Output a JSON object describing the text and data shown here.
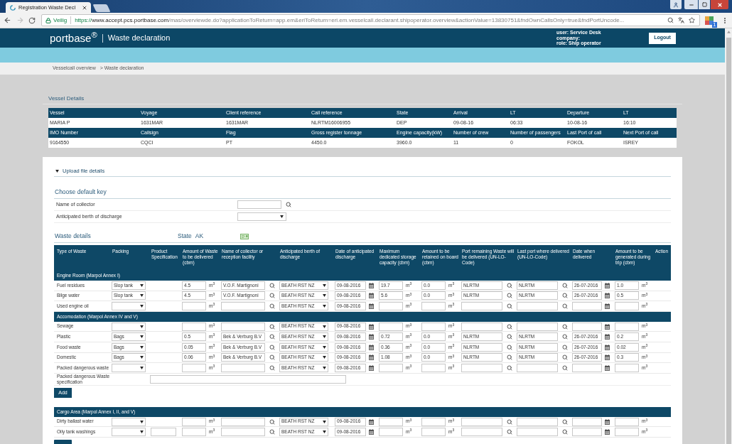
{
  "browser": {
    "tab_title": "Registration Waste Decl",
    "security_label": "Veilig",
    "url": {
      "scheme": "https://",
      "host": "www.accept.pcs.portbase.com",
      "path": "/mas/overviewde.do?applicationToReturn=app.em&eriToReturn=eri.em.vesselcall.declarant.shipoperator.overview&actionValue=13830751&fndOwnCallsOnly=true&fndPortUncode..."
    },
    "extension_badge": "1"
  },
  "header": {
    "logo": "portbase$^{®}$",
    "title": "Waste declaration",
    "user_lines": [
      "user: Service Desk",
      "company:",
      "role: Ship operator"
    ],
    "logout": "Logout"
  },
  "breadcrumb": [
    "Vesselcall overview",
    "> Waste declaration"
  ],
  "vessel_details": {
    "title": "Vessel Details",
    "groups": [
      {
        "columns": [
          "Vessel",
          "Voyage",
          "Client reference",
          "Call reference",
          "State",
          "Arrival",
          "LT",
          "Departure",
          "LT"
        ],
        "values": [
          "MARIA P",
          "1631MAR",
          "1631MAR",
          "NLRTM16006955",
          "DEP",
          "09-08-16",
          "06:33",
          "10-08-16",
          "16:10"
        ]
      },
      {
        "columns": [
          "IMO Number",
          "Callsign",
          "Flag",
          "Gross register tonnage",
          "Engine capacity(kW)",
          "Number of crew",
          "Number of passengers",
          "Last Port of call",
          "Next Port of call"
        ],
        "values": [
          "9164550",
          "CQCI",
          "PT",
          "4450.0",
          "3960.0",
          "11",
          "0",
          "FOKOL",
          "ISREY"
        ]
      }
    ]
  },
  "upload": {
    "label": "Upload file details"
  },
  "default_key": {
    "title": "Choose default key",
    "fields": [
      {
        "label": "Name of collector",
        "kind": "search"
      },
      {
        "label": "Anticipated berth of discharge",
        "kind": "select"
      }
    ]
  },
  "waste_details": {
    "title": "Waste details",
    "state_label": "State",
    "state_value": "AK"
  },
  "waste_table": {
    "columns": [
      "Type of Waste",
      "Packing",
      "Product Specification",
      "Amount of Waste to be delivered (cbm)",
      "Name of collector or reception facility",
      "Anticipated berth of discharge",
      "Date of anticipated discharge",
      "Maximum dedicated storage capacity (cbm)",
      "Amount to be retained on board (cbm)",
      "Port remaining Waste will be delivered (UN-LO-Code)",
      "Last port where delivered (UN-LO-Code)",
      "Date when delivered",
      "Amount to be generated during trip (cbm)",
      "Action"
    ],
    "sections": [
      {
        "title": "Engine Room (Marpol Annex I)",
        "rows": [
          {
            "type": "Fuel residues",
            "cells": [
              {
                "kind": "select",
                "value": "Slop tank"
              },
              {
                "kind": "blank"
              },
              {
                "kind": "input",
                "value": "4.5",
                "unit": "m$^{3}$"
              },
              {
                "kind": "search",
                "value": "V.O.F. Martignoni"
              },
              {
                "kind": "select",
                "value": "BEATH RST NZ"
              },
              {
                "kind": "date",
                "value": "09-08-2016"
              },
              {
                "kind": "input",
                "value": "19.7",
                "unit": "m$^{3}$"
              },
              {
                "kind": "input",
                "value": "0.0",
                "unit": "m$^{3}$"
              },
              {
                "kind": "search",
                "value": "NLRTM"
              },
              {
                "kind": "search",
                "value": "NLRTM"
              },
              {
                "kind": "date",
                "value": "26-07-2016"
              },
              {
                "kind": "input",
                "value": "1.0",
                "unit": "m$^{3}$"
              }
            ]
          },
          {
            "type": "Bilge water",
            "cells": [
              {
                "kind": "select",
                "value": "Slop tank"
              },
              {
                "kind": "blank"
              },
              {
                "kind": "input",
                "value": "4.5",
                "unit": "m$^{3}$"
              },
              {
                "kind": "search",
                "value": "V.O.F. Martignoni"
              },
              {
                "kind": "select",
                "value": "BEATH RST NZ"
              },
              {
                "kind": "date",
                "value": "09-08-2016"
              },
              {
                "kind": "input",
                "value": "5.6",
                "unit": "m$^{3}$"
              },
              {
                "kind": "input",
                "value": "0.0",
                "unit": "m$^{3}$"
              },
              {
                "kind": "search",
                "value": "NLRTM"
              },
              {
                "kind": "search",
                "value": "NLRTM"
              },
              {
                "kind": "date",
                "value": "26-07-2016"
              },
              {
                "kind": "input",
                "value": "0.5",
                "unit": "m$^{3}$"
              }
            ]
          },
          {
            "type": "Used engine oil",
            "cells": [
              {
                "kind": "select"
              },
              {
                "kind": "blank"
              },
              {
                "kind": "input",
                "unit": "m$^{3}$"
              },
              {
                "kind": "search"
              },
              {
                "kind": "select",
                "value": "BEATH RST NZ"
              },
              {
                "kind": "date",
                "value": "09-08-2016"
              },
              {
                "kind": "input",
                "unit": "m$^{3}$"
              },
              {
                "kind": "input",
                "unit": "m$^{3}$"
              },
              {
                "kind": "search"
              },
              {
                "kind": "search"
              },
              {
                "kind": "date"
              },
              {
                "kind": "input",
                "unit": "m$^{3}$"
              }
            ]
          }
        ]
      },
      {
        "title": "Accomodation (Marpol Annex IV and V)",
        "rows": [
          {
            "type": "Sewage",
            "cells": [
              {
                "kind": "select"
              },
              {
                "kind": "blank"
              },
              {
                "kind": "input",
                "unit": "m$^{3}$"
              },
              {
                "kind": "search"
              },
              {
                "kind": "select",
                "value": "BEATH RST NZ"
              },
              {
                "kind": "date",
                "value": "09-08-2016"
              },
              {
                "kind": "input",
                "unit": "m$^{3}$"
              },
              {
                "kind": "input",
                "unit": "m$^{3}$"
              },
              {
                "kind": "search"
              },
              {
                "kind": "search"
              },
              {
                "kind": "date"
              },
              {
                "kind": "input",
                "unit": "m$^{3}$"
              }
            ]
          },
          {
            "type": "Plastic",
            "cells": [
              {
                "kind": "select",
                "value": "Bags"
              },
              {
                "kind": "blank"
              },
              {
                "kind": "input",
                "value": "0.5",
                "unit": "m$^{3}$"
              },
              {
                "kind": "search",
                "value": "Bek & Verburg B.V"
              },
              {
                "kind": "select",
                "value": "BEATH RST NZ"
              },
              {
                "kind": "date",
                "value": "09-08-2016"
              },
              {
                "kind": "input",
                "value": "0.72",
                "unit": "m$^{3}$"
              },
              {
                "kind": "input",
                "value": "0.0",
                "unit": "m$^{3}$"
              },
              {
                "kind": "search",
                "value": "NLRTM"
              },
              {
                "kind": "search",
                "value": "NLRTM"
              },
              {
                "kind": "date",
                "value": "26-07-2016"
              },
              {
                "kind": "input",
                "value": "0.2",
                "unit": "m$^{3}$"
              }
            ]
          },
          {
            "type": "Food waste",
            "cells": [
              {
                "kind": "select",
                "value": "Bags"
              },
              {
                "kind": "blank"
              },
              {
                "kind": "input",
                "value": "0.05",
                "unit": "m$^{3}$"
              },
              {
                "kind": "search",
                "value": "Bek & Verburg B.V"
              },
              {
                "kind": "select",
                "value": "BEATH RST NZ"
              },
              {
                "kind": "date",
                "value": "09-08-2016"
              },
              {
                "kind": "input",
                "value": "0.36",
                "unit": "m$^{3}$"
              },
              {
                "kind": "input",
                "value": "0.0",
                "unit": "m$^{3}$"
              },
              {
                "kind": "search",
                "value": "NLRTM"
              },
              {
                "kind": "search",
                "value": "NLRTM"
              },
              {
                "kind": "date",
                "value": "26-07-2016"
              },
              {
                "kind": "input",
                "value": "0.02",
                "unit": "m$^{3}$"
              }
            ]
          },
          {
            "type": "Domestic",
            "cells": [
              {
                "kind": "select",
                "value": "Bags"
              },
              {
                "kind": "blank"
              },
              {
                "kind": "input",
                "value": "0.06",
                "unit": "m$^{3}$"
              },
              {
                "kind": "search",
                "value": "Bek & Verburg B.V"
              },
              {
                "kind": "select",
                "value": "BEATH RST NZ"
              },
              {
                "kind": "date",
                "value": "09-08-2016"
              },
              {
                "kind": "input",
                "value": "1.08",
                "unit": "m$^{3}$"
              },
              {
                "kind": "input",
                "value": "0.0",
                "unit": "m$^{3}$"
              },
              {
                "kind": "search",
                "value": "NLRTM"
              },
              {
                "kind": "search",
                "value": "NLRTM"
              },
              {
                "kind": "date",
                "value": "26-07-2016"
              },
              {
                "kind": "input",
                "value": "0.3",
                "unit": "m$^{3}$"
              }
            ]
          },
          {
            "type": "Packed dangerous waste",
            "cells": [
              {
                "kind": "select"
              },
              {
                "kind": "blank"
              },
              {
                "kind": "input",
                "unit": "m$^{3}$"
              },
              {
                "kind": "search"
              },
              {
                "kind": "select",
                "value": "BEATH RST NZ"
              },
              {
                "kind": "date",
                "value": "09-08-2016"
              },
              {
                "kind": "input",
                "unit": "m$^{3}$"
              },
              {
                "kind": "input",
                "unit": "m$^{3}$"
              },
              {
                "kind": "search"
              },
              {
                "kind": "search"
              },
              {
                "kind": "date"
              },
              {
                "kind": "input",
                "unit": "m$^{3}$"
              }
            ]
          }
        ],
        "specification": {
          "label": "Packed dangerous Waste specification"
        },
        "button": "Add"
      },
      {
        "title": "Cargo Area (Marpol Annex I, II, and V)",
        "rows": [
          {
            "type": "Dirty ballast water",
            "cells": [
              {
                "kind": "select"
              },
              {
                "kind": "blank"
              },
              {
                "kind": "input",
                "unit": "m$^{3}$"
              },
              {
                "kind": "search"
              },
              {
                "kind": "select",
                "value": "BEATH RST NZ"
              },
              {
                "kind": "date",
                "value": "09-08-2016"
              },
              {
                "kind": "input",
                "unit": "m$^{3}$"
              },
              {
                "kind": "input",
                "unit": "m$^{3}$"
              },
              {
                "kind": "search"
              },
              {
                "kind": "search"
              },
              {
                "kind": "date"
              },
              {
                "kind": "input",
                "unit": "m$^{3}$"
              }
            ]
          },
          {
            "type": "Oily tank washings",
            "cells": [
              {
                "kind": "select"
              },
              {
                "kind": "input"
              },
              {
                "kind": "input",
                "unit": "m$^{3}$"
              },
              {
                "kind": "search"
              },
              {
                "kind": "select",
                "value": "BEATH RST NZ"
              },
              {
                "kind": "date",
                "value": "09-08-2016"
              },
              {
                "kind": "input",
                "unit": "m$^{3}$"
              },
              {
                "kind": "input",
                "unit": "m$^{3}$"
              },
              {
                "kind": "search"
              },
              {
                "kind": "search"
              },
              {
                "kind": "date"
              },
              {
                "kind": "input",
                "unit": "m$^{3}$"
              }
            ]
          }
        ]
      }
    ]
  }
}
